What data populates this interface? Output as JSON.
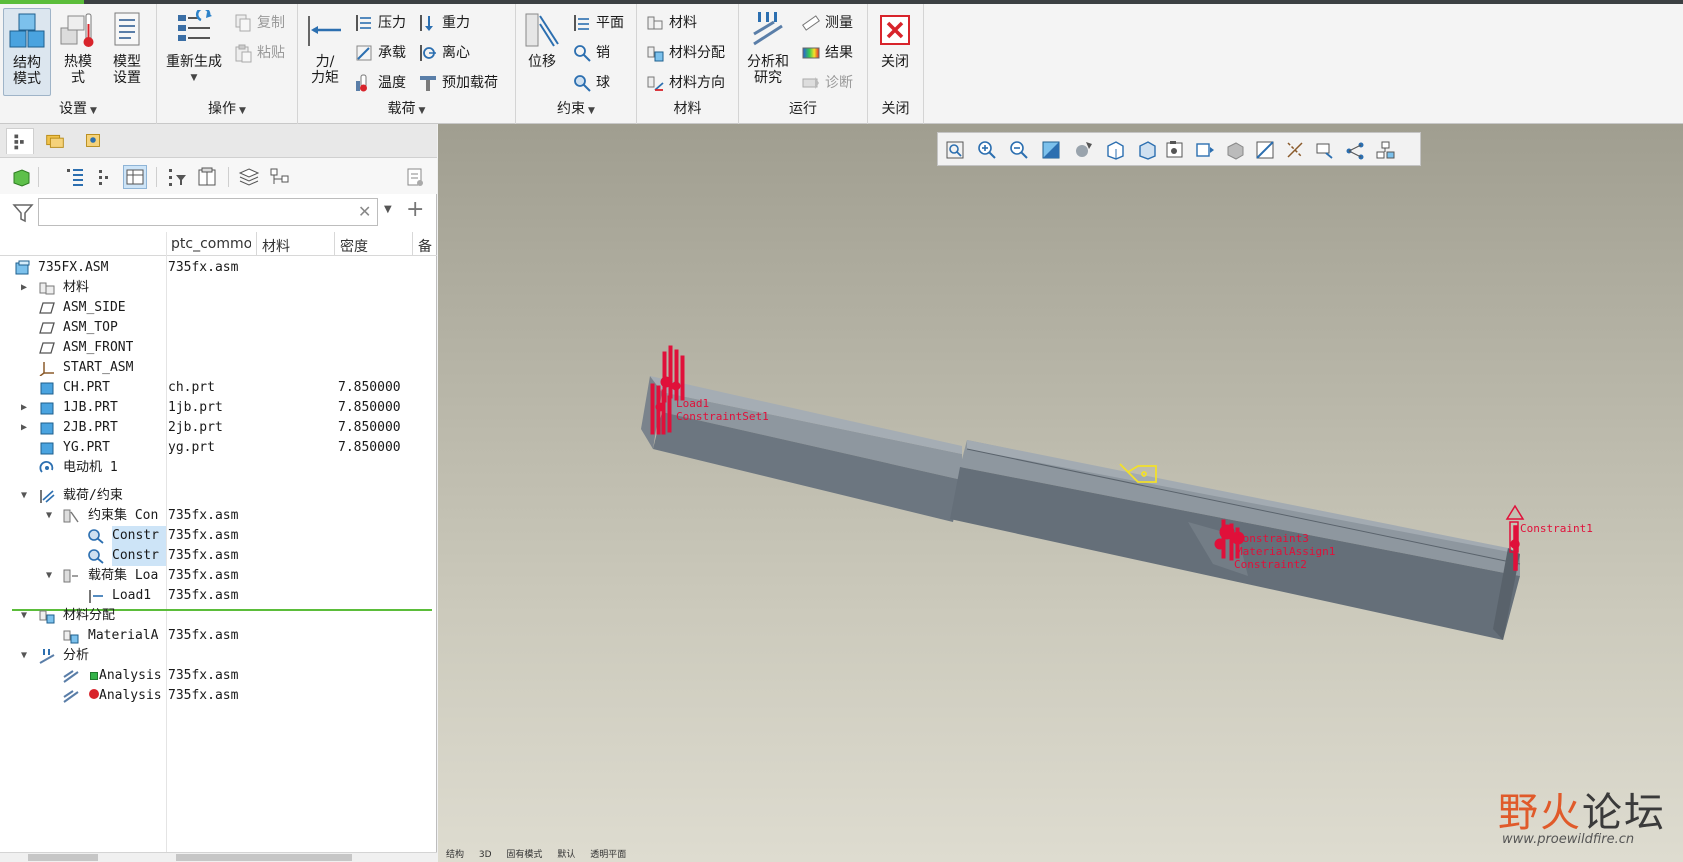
{
  "ribbon": {
    "groups": {
      "setup": "设置",
      "operations": "操作",
      "loads": "载荷",
      "constraints": "约束",
      "materials": "材料",
      "run": "运行",
      "close": "关闭"
    },
    "setup": {
      "structure_mode_l1": "结构",
      "structure_mode_l2": "模式",
      "thermal_mode_l1": "热模",
      "thermal_mode_l2": "式",
      "model_setup_l1": "模型",
      "model_setup_l2": "设置"
    },
    "operations": {
      "regenerate": "重新生成",
      "copy": "复制",
      "paste": "粘贴"
    },
    "loads": {
      "force_moment_l1": "力/",
      "force_moment_l2": "力矩",
      "pressure": "压力",
      "gravity": "重力",
      "bearing": "承载",
      "centrifugal": "离心",
      "temperature": "温度",
      "preload": "预加载荷"
    },
    "constraints": {
      "displacement": "位移",
      "plane": "平面",
      "pin": "销",
      "ball": "球"
    },
    "materials": {
      "material": "材料",
      "material_assignment": "材料分配",
      "material_orientation": "材料方向"
    },
    "run": {
      "analyses_l1": "分析和",
      "analyses_l2": "研究",
      "measure": "测量",
      "results": "结果",
      "diagnostics": "诊断"
    },
    "close": {
      "close": "关闭"
    }
  },
  "tree": {
    "filter_value": "",
    "columns": [
      "ptc_common",
      "材料",
      "密度",
      "备"
    ],
    "rows": [
      {
        "name": "735FX.ASM",
        "ptc": "735fx.asm",
        "density": ""
      },
      {
        "name": "材料",
        "ptc": "",
        "density": ""
      },
      {
        "name": "ASM_SIDE",
        "ptc": "",
        "density": ""
      },
      {
        "name": "ASM_TOP",
        "ptc": "",
        "density": ""
      },
      {
        "name": "ASM_FRONT",
        "ptc": "",
        "density": ""
      },
      {
        "name": "START_ASM",
        "ptc": "",
        "density": ""
      },
      {
        "name": "CH.PRT",
        "ptc": "ch.prt",
        "density": "7.850000"
      },
      {
        "name": "1JB.PRT",
        "ptc": "1jb.prt",
        "density": "7.850000"
      },
      {
        "name": "2JB.PRT",
        "ptc": "2jb.prt",
        "density": "7.850000"
      },
      {
        "name": "YG.PRT",
        "ptc": "yg.prt",
        "density": "7.850000"
      },
      {
        "name": "电动机 1",
        "ptc": "",
        "density": ""
      },
      {
        "name": "载荷/约束",
        "ptc": "",
        "density": ""
      },
      {
        "name": "约束集 Con",
        "ptc": "735fx.asm",
        "density": ""
      },
      {
        "name": "Constr",
        "ptc": "735fx.asm",
        "density": ""
      },
      {
        "name": "Constr",
        "ptc": "735fx.asm",
        "density": ""
      },
      {
        "name": "载荷集 Loa",
        "ptc": "735fx.asm",
        "density": ""
      },
      {
        "name": "Load1",
        "ptc": "735fx.asm",
        "density": ""
      },
      {
        "name": "材料分配",
        "ptc": "",
        "density": ""
      },
      {
        "name": "MaterialA",
        "ptc": "735fx.asm",
        "density": ""
      },
      {
        "name": "分析",
        "ptc": "",
        "density": ""
      },
      {
        "name": "Analysis",
        "ptc": "735fx.asm",
        "density": ""
      },
      {
        "name": "Analysis",
        "ptc": "735fx.asm",
        "density": ""
      }
    ]
  },
  "viewport": {
    "labels": {
      "load": "Load1",
      "constraint_a": "ConstraintSet1",
      "constraint_b": "Constraint1",
      "constraint_c": "Constraint2",
      "constraint_d": "Constraint3",
      "material": "MaterialAssign1"
    },
    "status": [
      "结构",
      "3D",
      "固有模式",
      "默认",
      "透明平面"
    ]
  },
  "watermark": {
    "title_a": "野火",
    "title_b": "论坛",
    "url": "www.proewildfire.cn"
  },
  "colors": {
    "accent_green": "#5bbd3a",
    "constraint_red": "#e0103a",
    "beam_gray": "#6c7680",
    "selection_blue": "#cde4f7"
  }
}
